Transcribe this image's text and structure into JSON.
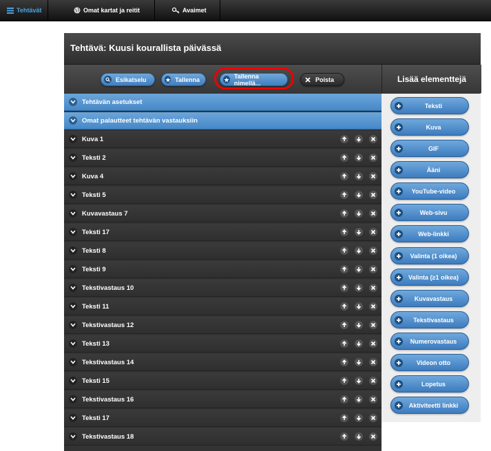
{
  "nav": {
    "items": [
      {
        "label": "Tehtävät",
        "icon": "list-icon"
      },
      {
        "label": "Omat kartat ja reitit",
        "icon": "globe-icon"
      },
      {
        "label": "Avaimet",
        "icon": "key-icon"
      }
    ]
  },
  "task": {
    "title": "Tehtävä: Kuusi kourallista päivässä"
  },
  "toolbar": {
    "preview_label": "Esikatselu",
    "save_label": "Tallenna",
    "save_as_label": "Tallenna nimellä...",
    "delete_label": "Poista"
  },
  "sidebar": {
    "title": "Lisää elementtejä",
    "buttons": [
      "Teksti",
      "Kuva",
      "GIF",
      "Ääni",
      "YouTube-video",
      "Web-sivu",
      "Web-linkki",
      "Valinta (1 oikea)",
      "Valinta (≥1 oikea)",
      "Kuvavastaus",
      "Tekstivastaus",
      "Numerovastaus",
      "Videon otto",
      "Lopetus",
      "Aktiviteetti linkki"
    ]
  },
  "sections": [
    "Tehtävän asetukset",
    "Omat palautteet tehtävän vastauksiin"
  ],
  "elements": [
    "Kuva 1",
    "Teksti 2",
    "Kuva 4",
    "Teksti 5",
    "Kuvavastaus 7",
    "Teksti 17",
    "Teksti 8",
    "Teksti 9",
    "Tekstivastaus 10",
    "Teksti 11",
    "Tekstivastaus 12",
    "Teksti 13",
    "Tekstivastaus 14",
    "Teksti 15",
    "Tekstivastaus 16",
    "Teksti 17",
    "Tekstivastaus 18"
  ],
  "colors": {
    "accent_blue": "#4a8fd0",
    "highlight_red": "#e00000",
    "row_dark": "#333333"
  }
}
